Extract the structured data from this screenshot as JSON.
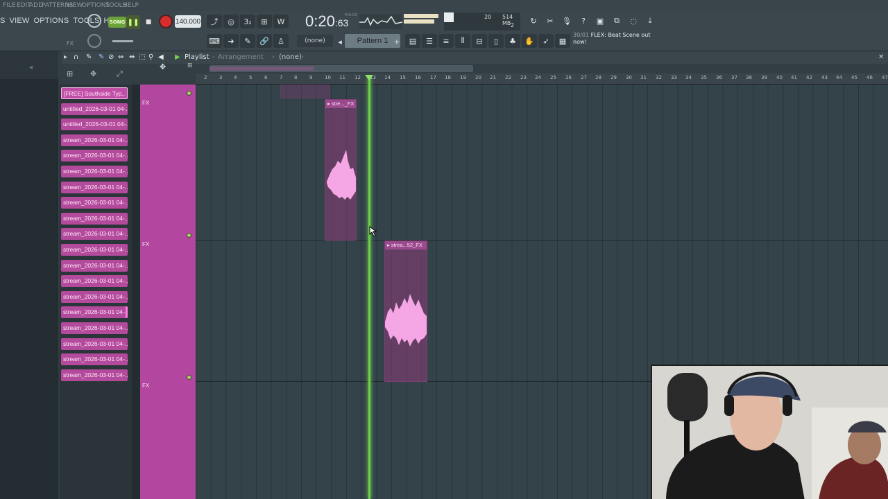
{
  "ghost_menu": [
    "FILE",
    "EDIT",
    "ADD",
    "PATTERNS",
    "VIEW",
    "OPTIONS",
    "TOOLS",
    "HELP"
  ],
  "menu": [
    "S",
    "VIEW",
    "OPTIONS",
    "TOOLS",
    "HELP"
  ],
  "transport": {
    "song_label": "SONG",
    "tempo": "140.000",
    "time_main": "0:20",
    "time_frac": "63",
    "time_sub": "M:S:CS",
    "fx_label": "FX"
  },
  "cpu": {
    "a": "20",
    "b": "514 MB",
    "c": "2"
  },
  "pattern": {
    "label": "Pattern 1",
    "none_label": "(none)"
  },
  "news": {
    "date": "30/01",
    "text": "FLEX: Beat Scene out now!"
  },
  "playlist": {
    "title": "Playlist",
    "title_sep": "-",
    "title_view": "Arrangement",
    "title_arrow": "›",
    "title_none": "(none)",
    "title_arrow2": "›"
  },
  "patterns": [
    "[FREE] Southside Typ..",
    "untitled_2026-03-01 04-..",
    "untitled_2026-03-01 04-..",
    "stream_2026-03-01 04-..",
    "stream_2026-03-01 04-..",
    "stream_2026-03-01 04-..",
    "stream_2026-03-01 04-..",
    "stream_2026-03-01 04-..",
    "stream_2026-03-01 04-..",
    "stream_2026-03-01 04-..",
    "stream_2026-03-01 04-..",
    "stream_2026-03-01 04-..",
    "stream_2026-03-01 04-..",
    "stream_2026-03-01 04-..",
    "stream_2026-03-01 04-..",
    "stream_2026-03-01 04-..",
    "stream_2026-03-01 04-..",
    "stream_2026-03-01 04-..",
    "stream_2026-03-01 04-.."
  ],
  "tracks": [
    "FX",
    "FX",
    "FX"
  ],
  "ruler": [
    "2",
    "3",
    "4",
    "5",
    "6",
    "7",
    "8",
    "9",
    "10",
    "11",
    "12",
    "13",
    "14",
    "15",
    "16",
    "17",
    "18",
    "19",
    "20",
    "21",
    "22",
    "23",
    "24",
    "25",
    "26",
    "27",
    "28",
    "29",
    "30",
    "31",
    "32",
    "33",
    "34",
    "35",
    "36",
    "37",
    "38",
    "39",
    "40",
    "41",
    "42",
    "43",
    "44",
    "45",
    "46",
    "47"
  ],
  "clips": [
    {
      "label": "▸ stre..._FX"
    },
    {
      "label": "▸ strea...52_FX"
    }
  ],
  "colors": {
    "accent": "#6cd14a",
    "clip": "#b347a0",
    "waveform": "#f5a6e4"
  },
  "icons": [
    "playlist-icon",
    "draw-icon",
    "paint-icon",
    "delete-icon",
    "mute-icon",
    "slice-icon",
    "select-icon",
    "zoom-icon",
    "playback-icon"
  ]
}
